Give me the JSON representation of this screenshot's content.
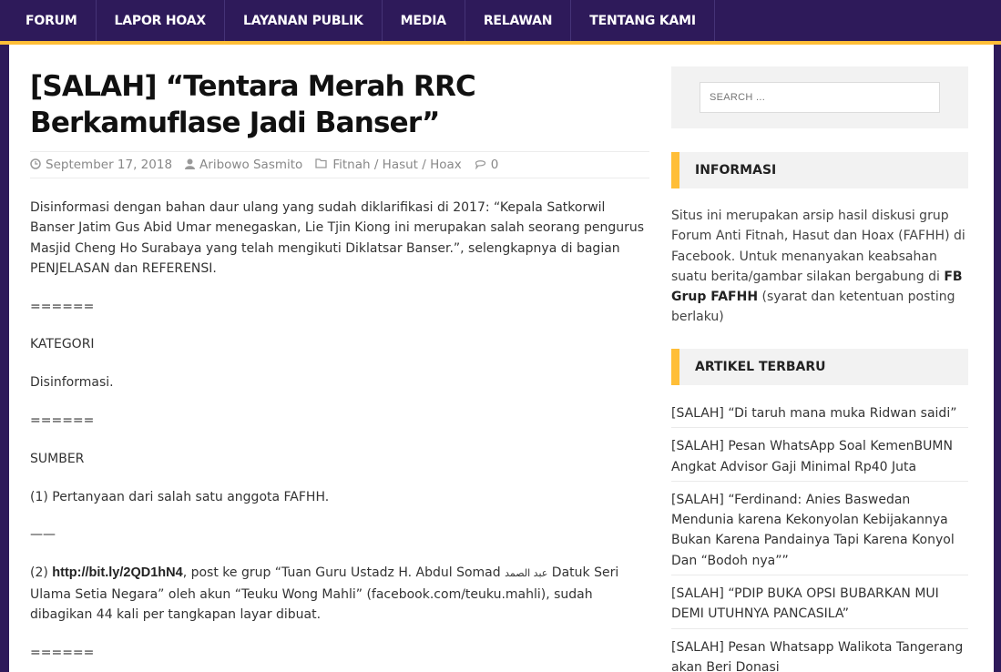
{
  "nav": {
    "items": [
      "FORUM",
      "LAPOR HOAX",
      "LAYANAN PUBLIK",
      "MEDIA",
      "RELAWAN",
      "TENTANG KAMI"
    ]
  },
  "post": {
    "title": "[SALAH] “Tentara Merah RRC Berkamuflase Jadi Banser”",
    "date": "September 17, 2018",
    "author": "Aribowo Sasmito",
    "category": "Fitnah / Hasut / Hoax",
    "comments": "0",
    "paragraphs": {
      "intro": "Disinformasi dengan bahan daur ulang yang sudah diklarifikasi di 2017: “Kepala Satkorwil Banser Jatim Gus Abid Umar menegaskan, Lie Tjin Kiong ini merupakan salah seorang pengurus Masjid Cheng Ho Surabaya yang telah mengikuti Diklatsar Banser.”, selengkapnya di bagian PENJELASAN dan REFERENSI.",
      "sep1": "======",
      "kategori": "KATEGORI",
      "disinformasi": "Disinformasi.",
      "sep2": "======",
      "sumber": "SUMBER",
      "src1": "(1) Pertanyaan dari salah satu anggota FAFHH.",
      "dash": "——",
      "src2_prefix": "(2) ",
      "src2_link": "http://bit.ly/2QD1hN4",
      "src2_mid": ", post ke grup “Tuan Guru Ustadz H. Abdul Somad ",
      "src2_arabic": "عبد الصمد",
      "src2_suffix": " Datuk Seri Ulama Setia Negara” oleh akun “Teuku Wong Mahli” (facebook.com/teuku.mahli), sudah dibagikan 44 kali per tangkapan layar dibuat.",
      "sep3": "======"
    }
  },
  "sidebar": {
    "search_placeholder": "SEARCH ...",
    "info_title": "INFORMASI",
    "info_text_1": "Situs ini merupakan arsip hasil diskusi grup Forum Anti Fitnah, Hasut dan Hoax (FAFHH) di Facebook. Untuk menanyakan keabsahan suatu berita/gambar silakan bergabung di ",
    "info_link": "FB Grup FAFHH",
    "info_text_2": " (syarat dan ketentuan posting berlaku)",
    "recent_title": "ARTIKEL TERBARU",
    "recent": [
      "[SALAH] “Di taruh mana muka Ridwan saidi”",
      "[SALAH] Pesan WhatsApp Soal KemenBUMN Angkat Advisor Gaji Minimal Rp40 Juta",
      "[SALAH] “Ferdinand: Anies Baswedan Mendunia karena Kekonyolan Kebijakannya Bukan Karena Pandainya Tapi Karena Konyol Dan “Bodoh nya””",
      "[SALAH] “PDIP BUKA OPSI BUBARKAN MUI DEMI UTUHNYA PANCASILA”",
      "[SALAH] Pesan Whatsapp Walikota Tangerang akan Beri Donasi"
    ]
  },
  "colors": {
    "nav_bg": "#2e1a5a",
    "accent": "#ffbe37"
  }
}
